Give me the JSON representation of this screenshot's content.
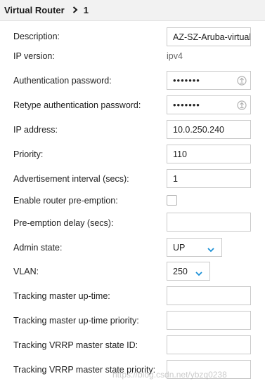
{
  "header": {
    "title": "Virtual Router",
    "separator_icon": "chevron-right-icon",
    "id": "1"
  },
  "form": {
    "description": {
      "label": "Description:",
      "value": "AZ-SZ-Aruba-virtual-"
    },
    "ip_version": {
      "label": "IP version:",
      "value": "ipv4"
    },
    "auth_password": {
      "label": "Authentication password:",
      "value": "•••••••"
    },
    "retype_password": {
      "label": "Retype authentication password:",
      "value": "•••••••"
    },
    "ip_address": {
      "label": "IP address:",
      "value": "10.0.250.240"
    },
    "priority": {
      "label": "Priority:",
      "value": "110"
    },
    "adv_interval": {
      "label": "Advertisement interval (secs):",
      "value": "1"
    },
    "preemption": {
      "label": "Enable router pre-emption:",
      "checked": false
    },
    "preemption_delay": {
      "label": "Pre-emption delay (secs):",
      "value": ""
    },
    "admin_state": {
      "label": "Admin state:",
      "value": "UP"
    },
    "vlan": {
      "label": "VLAN:",
      "value": "250"
    },
    "tracking_uptime": {
      "label": "Tracking master up-time:",
      "value": ""
    },
    "tracking_uptime_priority": {
      "label": "Tracking master up-time priority:",
      "value": ""
    },
    "tracking_vrrp_state_id": {
      "label": "Tracking VRRP master state ID:",
      "value": ""
    },
    "tracking_vrrp_state_priority": {
      "label": "Tracking VRRP master state priority:",
      "value": ""
    }
  },
  "watermark": "https://blog.csdn.net/ybzq0238",
  "colors": {
    "caret": "#1a8fd6",
    "header_bg": "#f2f2f2"
  }
}
